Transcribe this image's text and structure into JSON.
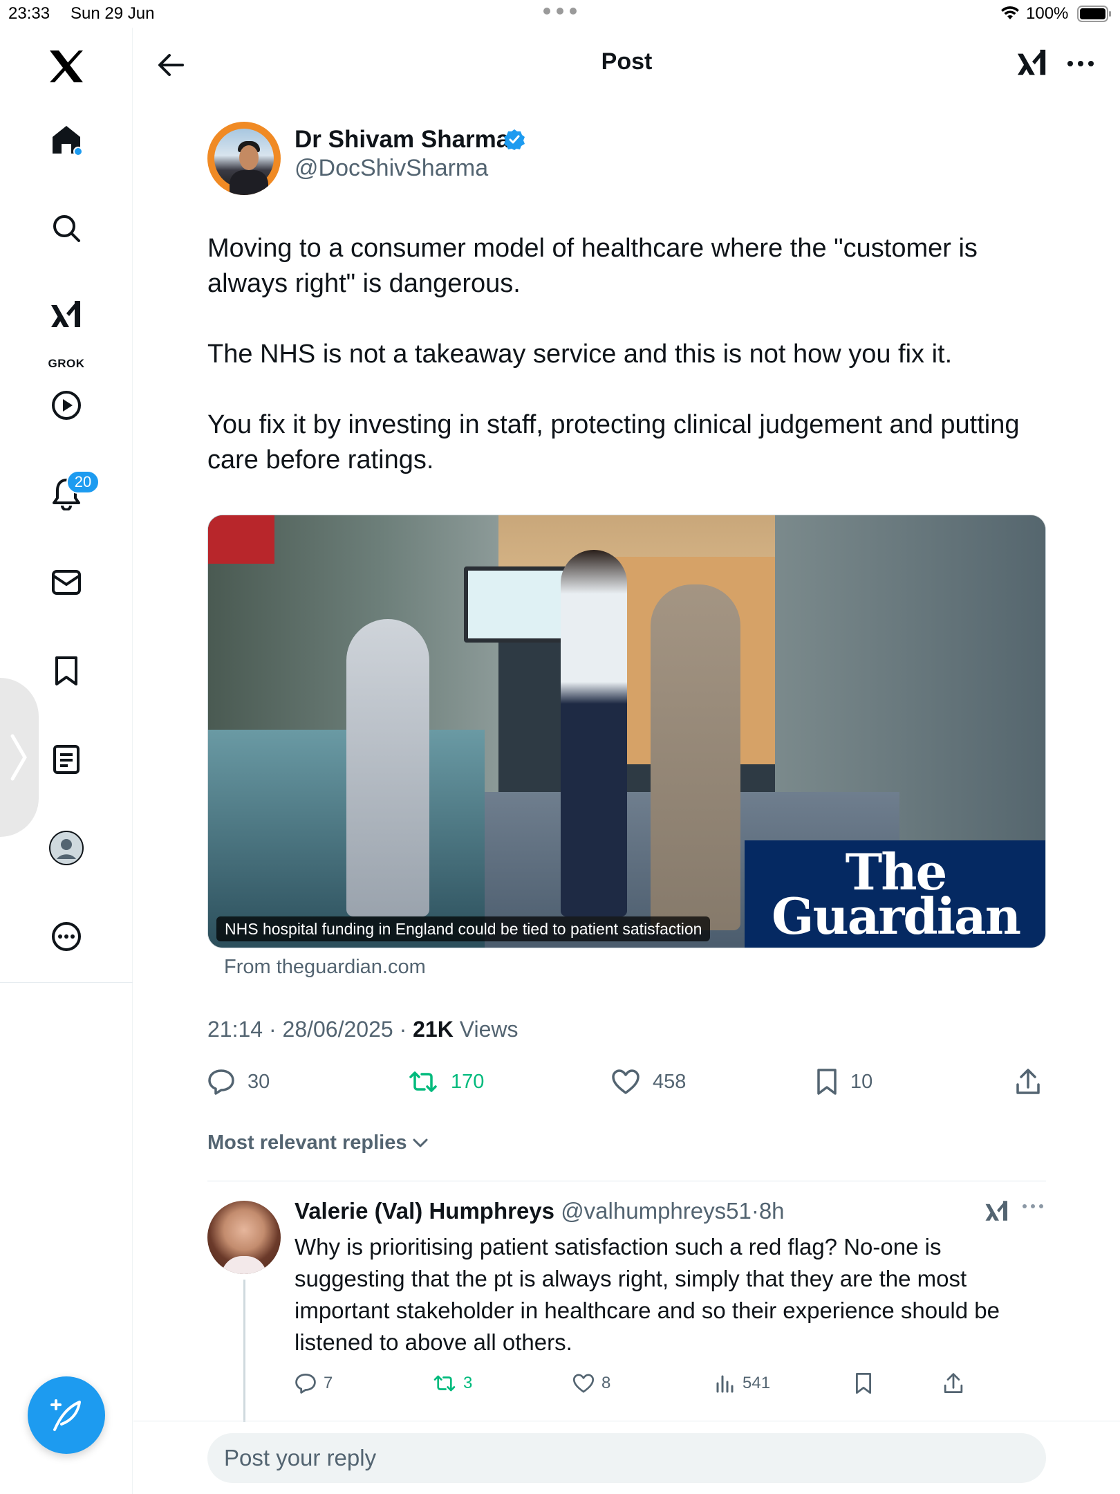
{
  "status_bar": {
    "time": "23:33",
    "date": "Sun 29 Jun",
    "battery": "100%"
  },
  "sidebar": {
    "items": [
      {
        "name": "x-logo"
      },
      {
        "name": "home-icon"
      },
      {
        "name": "search-icon"
      },
      {
        "name": "grok-icon",
        "label": "GROK"
      },
      {
        "name": "video-icon"
      },
      {
        "name": "bell-icon",
        "badge": "20"
      },
      {
        "name": "mail-icon"
      },
      {
        "name": "bookmark-icon"
      },
      {
        "name": "lists-icon"
      },
      {
        "name": "profile-icon"
      },
      {
        "name": "more-icon"
      }
    ]
  },
  "header": {
    "title": "Post"
  },
  "post": {
    "author_name": "Dr Shivam Sharma",
    "author_handle": "@DocShivSharma",
    "paragraphs": [
      "Moving to a consumer model of healthcare where the \"customer is always right\" is dangerous.",
      "The NHS is not a takeaway service and this is not how you fix it.",
      "You fix it by investing in staff, protecting clinical judgement and putting care before ratings."
    ],
    "card": {
      "caption": "NHS hospital funding in England could be tied to patient satisfaction",
      "brand_line1": "The",
      "brand_line2": "Guardian",
      "source": "From theguardian.com"
    },
    "meta": {
      "time": "21:14",
      "date": "28/06/2025",
      "views_count": "21K",
      "views_label": "Views"
    },
    "actions": {
      "replies": "30",
      "reposts": "170",
      "likes": "458",
      "bookmarks": "10"
    }
  },
  "replies_sort": "Most relevant replies",
  "reply": {
    "name": "Valerie (Val) Humphreys",
    "handle": "@valhumphreys51",
    "age": "8h",
    "text": "Why is prioritising patient satisfaction such a red flag? No-one is suggesting that the pt is always right, simply that they are the most important stakeholder in healthcare and so their experience should be listened to above all others.",
    "actions": {
      "replies": "7",
      "reposts": "3",
      "likes": "8",
      "views": "541"
    }
  },
  "reply_box": {
    "placeholder": "Post your reply"
  },
  "colors": {
    "accent": "#1d9bf0",
    "repost_green": "#00ba7c",
    "guardian_blue": "#052962",
    "secondary_text": "#536471"
  }
}
